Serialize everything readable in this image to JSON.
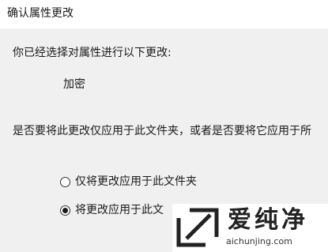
{
  "dialog": {
    "title": "确认属性更改",
    "intro": "你已经选择对属性进行以下更改:",
    "attribute": "加密",
    "question": "是否要将此更改仅应用于此文件夹，或者是否要将它应用于所",
    "options": [
      {
        "label": "仅将更改应用于此文件夹",
        "selected": false
      },
      {
        "label": "将更改应用于此文",
        "selected": true
      }
    ]
  },
  "watermark": {
    "brand": "爱纯净",
    "url": "aichunjing.com",
    "logo_icon": "diagonal-window-logo"
  }
}
